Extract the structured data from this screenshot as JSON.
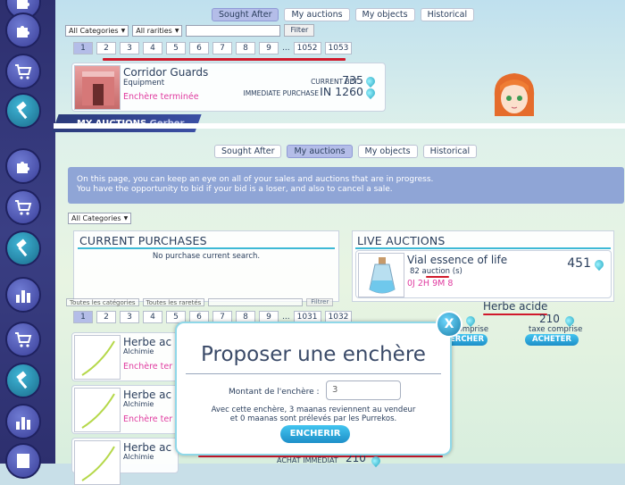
{
  "tabs_top": [
    "Sought After",
    "My auctions",
    "My objects",
    "Historical"
  ],
  "tabs_top_active": 0,
  "filters_top": {
    "category": "All Categories",
    "rarity": "All rarities",
    "button": "Filter"
  },
  "pager_top": [
    "1",
    "2",
    "3",
    "4",
    "5",
    "6",
    "7",
    "8",
    "9",
    "...",
    "1052",
    "1053"
  ],
  "auction_item": {
    "name": "Corridor Guards",
    "category": "Equipment",
    "status": "Enchère terminée",
    "current_bet_label": "CURRENT BET",
    "current_bet_value": "735",
    "immediate_label": "IMMEDIATE PURCHASE",
    "immediate_value": "IN 1260"
  },
  "strip_title": "MY AUCTIONS",
  "strip_sub": "Gerber",
  "tabs_mid": [
    "Sought After",
    "My auctions",
    "My objects",
    "Historical"
  ],
  "tabs_mid_active": 1,
  "info": {
    "line1": "On this page, you can keep an eye on all of your sales and auctions that are in progress.",
    "line2": "You have the opportunity to bid if your bid is a loser, and also to cancel a sale."
  },
  "filter_mid": {
    "category": "All Categories"
  },
  "current_purchases": {
    "title": "CURRENT PURCHASES",
    "empty": "No purchase current search."
  },
  "live_auctions": {
    "title": "LIVE AUCTIONS",
    "item_name": "Vial essence of life",
    "count_label": "82 auction (s)",
    "timer": "0J 2H 9M 8",
    "price": "451"
  },
  "pager_bottom": [
    "1",
    "2",
    "3",
    "4",
    "5",
    "6",
    "7",
    "8",
    "9",
    "...",
    "1031",
    "1032"
  ],
  "filters_bottom": {
    "category": "Toutes les catégories",
    "rarity": "Toutes les raretés",
    "button": "Filtrer"
  },
  "bottom_items": [
    {
      "name": "Herbe ac",
      "category": "Alchimie",
      "status": "Enchère ter"
    },
    {
      "name": "Herbe ac",
      "category": "Alchimie",
      "status": "Enchère ter"
    },
    {
      "name": "Herbe ac",
      "category": "Alchimie"
    }
  ],
  "right_item": {
    "name": "Herbe acide",
    "price": "210",
    "tax_label": "taxe comprise",
    "tax_label_left": "comprise",
    "buy_button": "ACHETER",
    "bid_button_partial": "ERCHER"
  },
  "bottom_footer": {
    "label": "ACHAT IMMÉDIAT",
    "value": "210"
  },
  "modal": {
    "title": "Proposer une enchère",
    "amount_label": "Montant de l'enchère :",
    "amount_value": "3",
    "note_line1": "Avec cette enchère, 3 maanas reviennent au vendeur",
    "note_line2": "et 0 maanas sont prélevés par les Purrekos.",
    "submit": "ENCHERIR",
    "close": "X"
  },
  "colors": {
    "accent": "#3db9d6",
    "underline": "#d0192b",
    "sidebar": "#2d2f6e",
    "status_pink": "#e03ca0"
  }
}
